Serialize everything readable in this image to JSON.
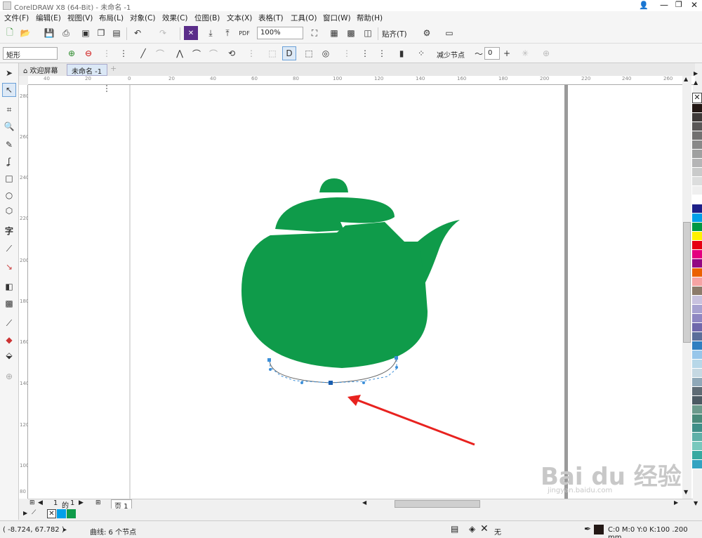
{
  "window": {
    "title": "CorelDRAW X8 (64-Bit) - 未命名 -1"
  },
  "menu": [
    "文件(F)",
    "编辑(E)",
    "视图(V)",
    "布局(L)",
    "对象(C)",
    "效果(C)",
    "位图(B)",
    "文本(X)",
    "表格(T)",
    "工具(O)",
    "窗口(W)",
    "帮助(H)"
  ],
  "toolbar": {
    "zoom": "100%",
    "snap": "贴齐(T)",
    "pdf": "PDF"
  },
  "propbar": {
    "shape_select": "矩形",
    "reduce_nodes": "减少节点",
    "smooth_value": "0"
  },
  "tabs": {
    "welcome": "欢迎屏幕",
    "doc": "未命名 -1"
  },
  "ruler_h": [
    "40",
    "20",
    "0",
    "20",
    "40",
    "60",
    "80",
    "100",
    "120",
    "140",
    "160",
    "180",
    "200",
    "220",
    "240",
    "260"
  ],
  "ruler_v": [
    "280",
    "260",
    "240",
    "220",
    "200",
    "180",
    "160",
    "140",
    "120",
    "100",
    "80"
  ],
  "pagebar": {
    "current": "1",
    "of": "的",
    "total": "1",
    "page_tab": "页 1"
  },
  "status": {
    "coords": "( -8.724, 67.782 )",
    "info": "曲线: 6 个节点",
    "fill_none": "无",
    "outline": "C:0 M:0 Y:0 K:100 .200 mm"
  },
  "watermark": {
    "text": "Bai du 经验",
    "url": "jingyan.baidu.com"
  },
  "colors": {
    "teapot": "#0f9b4a",
    "arrow": "#e8221f",
    "palette": [
      "#231815",
      "#3e3a39",
      "#595757",
      "#727171",
      "#898989",
      "#9fa0a0",
      "#b5b5b6",
      "#c9caca",
      "#dcdddd",
      "#efefef",
      "#ffffff",
      "#1d2088",
      "#00a0e9",
      "#009944",
      "#fff100",
      "#e60012",
      "#e4007f",
      "#920783",
      "#eb6100",
      "#f5a3a3",
      "#8c7b6b",
      "#c8c2df",
      "#a7a2d0",
      "#8e87c2",
      "#6f68ab",
      "#5a6e9a",
      "#2f7fc1",
      "#97c6ea",
      "#b7d7e8",
      "#c5d8e2",
      "#8fa8b8",
      "#5e6b74",
      "#4c5a63",
      "#6c9a8c",
      "#4a8a7a",
      "#3f8f88",
      "#5fb0a8",
      "#78c8bd",
      "#36a9a0",
      "#33a3c1"
    ]
  }
}
